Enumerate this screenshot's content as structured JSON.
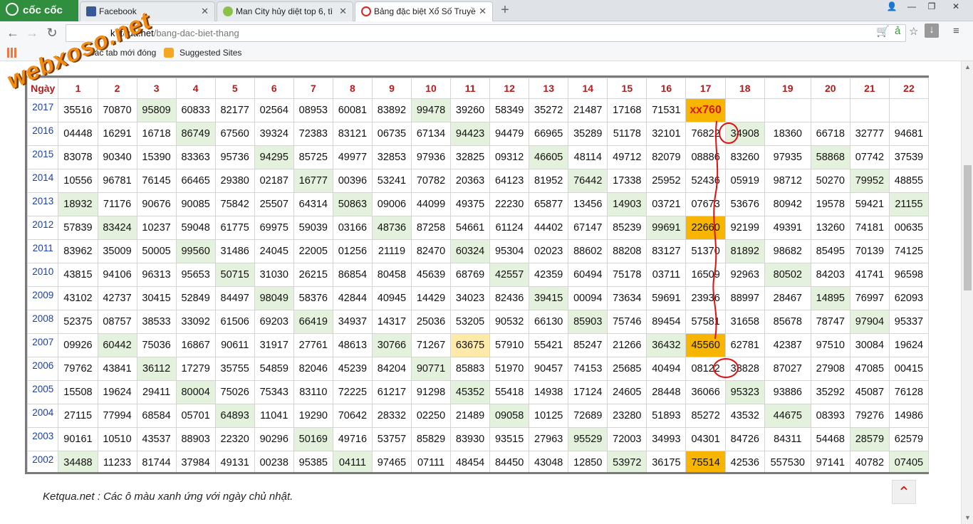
{
  "browser": {
    "brand": "cốc cốc",
    "tabs": [
      {
        "title": "Facebook"
      },
      {
        "title": "Man City hủy diệt top 6, tì"
      },
      {
        "title": "Bảng đặc biệt Xổ Số Truyề"
      }
    ],
    "url_prefix": "ketqua.net",
    "url_path": "/bang-dac-biet-thang",
    "bookmarks": [
      "Các tab mới đóng",
      "Suggested Sites"
    ]
  },
  "watermark": "webxoso.net",
  "table": {
    "corner": "Ngày",
    "columns": [
      "1",
      "2",
      "3",
      "4",
      "5",
      "6",
      "7",
      "8",
      "9",
      "10",
      "11",
      "12",
      "13",
      "14",
      "15",
      "16",
      "17",
      "18",
      "19",
      "20",
      "21",
      "22"
    ],
    "rows": [
      {
        "year": "2017",
        "cells": [
          "35516",
          "70870",
          "95809",
          "60833",
          "82177",
          "02564",
          "08953",
          "60081",
          "83892",
          "99478",
          "39260",
          "58349",
          "35272",
          "21487",
          "17168",
          "71531",
          "xx760",
          "",
          "",
          "",
          "",
          ""
        ],
        "green": [
          3,
          10
        ],
        "orange": [],
        "xx": [
          17
        ]
      },
      {
        "year": "2016",
        "cells": [
          "04448",
          "16291",
          "16718",
          "86749",
          "67560",
          "39324",
          "72383",
          "83121",
          "06735",
          "67134",
          "94423",
          "94479",
          "66965",
          "35289",
          "51178",
          "32101",
          "76822",
          "34908",
          "18360",
          "66718",
          "32777",
          "94681"
        ],
        "green": [
          4,
          11,
          18
        ],
        "orange": []
      },
      {
        "year": "2015",
        "cells": [
          "83078",
          "90340",
          "15390",
          "83363",
          "95736",
          "94295",
          "85725",
          "49977",
          "32853",
          "97936",
          "32825",
          "09312",
          "46605",
          "48114",
          "49712",
          "82079",
          "08886",
          "83260",
          "97935",
          "58868",
          "07742",
          "37539"
        ],
        "green": [
          6,
          13,
          20
        ],
        "orange": []
      },
      {
        "year": "2014",
        "cells": [
          "10556",
          "96781",
          "76145",
          "66465",
          "29380",
          "02187",
          "16777",
          "00396",
          "53241",
          "70782",
          "20363",
          "64123",
          "81952",
          "76442",
          "17338",
          "25952",
          "52436",
          "05919",
          "98712",
          "50270",
          "79952",
          "48855"
        ],
        "green": [
          7,
          14,
          21
        ],
        "orange": []
      },
      {
        "year": "2013",
        "cells": [
          "18932",
          "71176",
          "90676",
          "90085",
          "75842",
          "25507",
          "64314",
          "50863",
          "09006",
          "44099",
          "49375",
          "22230",
          "65877",
          "13456",
          "14903",
          "03721",
          "07673",
          "53676",
          "80942",
          "19578",
          "59421",
          "21155"
        ],
        "green": [
          1,
          8,
          15,
          22
        ],
        "orange": []
      },
      {
        "year": "2012",
        "cells": [
          "57839",
          "83424",
          "10237",
          "59048",
          "61775",
          "69975",
          "59039",
          "03166",
          "48736",
          "87258",
          "54661",
          "61124",
          "44402",
          "67147",
          "85239",
          "99691",
          "22660",
          "92199",
          "49391",
          "13260",
          "74181",
          "00635"
        ],
        "green": [
          2,
          9,
          16
        ],
        "orange": [
          17
        ]
      },
      {
        "year": "2011",
        "cells": [
          "83962",
          "35009",
          "50005",
          "99560",
          "31486",
          "24045",
          "22005",
          "01256",
          "21119",
          "82470",
          "60324",
          "95304",
          "02023",
          "88602",
          "88208",
          "83127",
          "51370",
          "81892",
          "98682",
          "85495",
          "70139",
          "74125"
        ],
        "green": [
          4,
          11,
          18
        ],
        "orange": []
      },
      {
        "year": "2010",
        "cells": [
          "43815",
          "94106",
          "96313",
          "95653",
          "50715",
          "31030",
          "26215",
          "86854",
          "80458",
          "45639",
          "68769",
          "42557",
          "42359",
          "60494",
          "75178",
          "03711",
          "16509",
          "92963",
          "80502",
          "84203",
          "41741",
          "96598"
        ],
        "green": [
          5,
          12,
          19
        ],
        "orange": []
      },
      {
        "year": "2009",
        "cells": [
          "43102",
          "42737",
          "30415",
          "52849",
          "84497",
          "98049",
          "58376",
          "42844",
          "40945",
          "14429",
          "34023",
          "82436",
          "39415",
          "00094",
          "73634",
          "59691",
          "23936",
          "88997",
          "28467",
          "14895",
          "76997",
          "62093"
        ],
        "green": [
          6,
          13,
          20
        ],
        "orange": []
      },
      {
        "year": "2008",
        "cells": [
          "52375",
          "08757",
          "38533",
          "33092",
          "61506",
          "69203",
          "66419",
          "34937",
          "14317",
          "25036",
          "53205",
          "90532",
          "66130",
          "85903",
          "75746",
          "89454",
          "57581",
          "31658",
          "85678",
          "78747",
          "97904",
          "95337"
        ],
        "green": [
          7,
          14,
          21
        ],
        "orange": []
      },
      {
        "year": "2007",
        "cells": [
          "09926",
          "60442",
          "75036",
          "16867",
          "90611",
          "31917",
          "27761",
          "48613",
          "30766",
          "71267",
          "63675",
          "57910",
          "55421",
          "85247",
          "21266",
          "36432",
          "45560",
          "62781",
          "42387",
          "97510",
          "30084",
          "19624"
        ],
        "green": [
          2,
          9,
          16
        ],
        "orange": [
          17
        ],
        "yellow": [
          11
        ]
      },
      {
        "year": "2006",
        "cells": [
          "79762",
          "43841",
          "36112",
          "17279",
          "35755",
          "54859",
          "82046",
          "45239",
          "84204",
          "90771",
          "85883",
          "51970",
          "90457",
          "74153",
          "25685",
          "40494",
          "08122",
          "38828",
          "87027",
          "27908",
          "47085",
          "00415"
        ],
        "green": [
          3,
          10
        ],
        "orange": []
      },
      {
        "year": "2005",
        "cells": [
          "15508",
          "19624",
          "29411",
          "80004",
          "75026",
          "75343",
          "83110",
          "72225",
          "61217",
          "91298",
          "45352",
          "55418",
          "14938",
          "17124",
          "24605",
          "28448",
          "36066",
          "95323",
          "93886",
          "35292",
          "45087",
          "76128"
        ],
        "green": [
          4,
          11,
          18
        ],
        "orange": []
      },
      {
        "year": "2004",
        "cells": [
          "27115",
          "77994",
          "68584",
          "05701",
          "64893",
          "11041",
          "19290",
          "70642",
          "28332",
          "02250",
          "21489",
          "09058",
          "10125",
          "72689",
          "23280",
          "51893",
          "85272",
          "43532",
          "44675",
          "08393",
          "79276",
          "14986"
        ],
        "green": [
          5,
          12,
          19
        ],
        "orange": []
      },
      {
        "year": "2003",
        "cells": [
          "90161",
          "10510",
          "43537",
          "88903",
          "22320",
          "90296",
          "50169",
          "49716",
          "53757",
          "85829",
          "83930",
          "93515",
          "27963",
          "95529",
          "72003",
          "34993",
          "04301",
          "84726",
          "84311",
          "54468",
          "28579",
          "62579"
        ],
        "green": [
          7,
          14,
          21
        ],
        "orange": []
      },
      {
        "year": "2002",
        "cells": [
          "34488",
          "11233",
          "81744",
          "37984",
          "49131",
          "00238",
          "95385",
          "04111",
          "97465",
          "07111",
          "48454",
          "84450",
          "43048",
          "12850",
          "53972",
          "36175",
          "75514",
          "42536",
          "557530",
          "97141",
          "40782",
          "07405"
        ],
        "green": [
          1,
          8,
          15,
          22
        ],
        "orange": [
          17
        ]
      }
    ]
  },
  "note": "Ketqua.net : Các ô màu xanh ứng với ngày chủ nhật.",
  "colors": {
    "green": "#e4f1dc",
    "orange": "#f7b500",
    "header_red": "#b21d1d",
    "year_blue": "#1a3fb0",
    "annotation_red": "#e01010"
  }
}
